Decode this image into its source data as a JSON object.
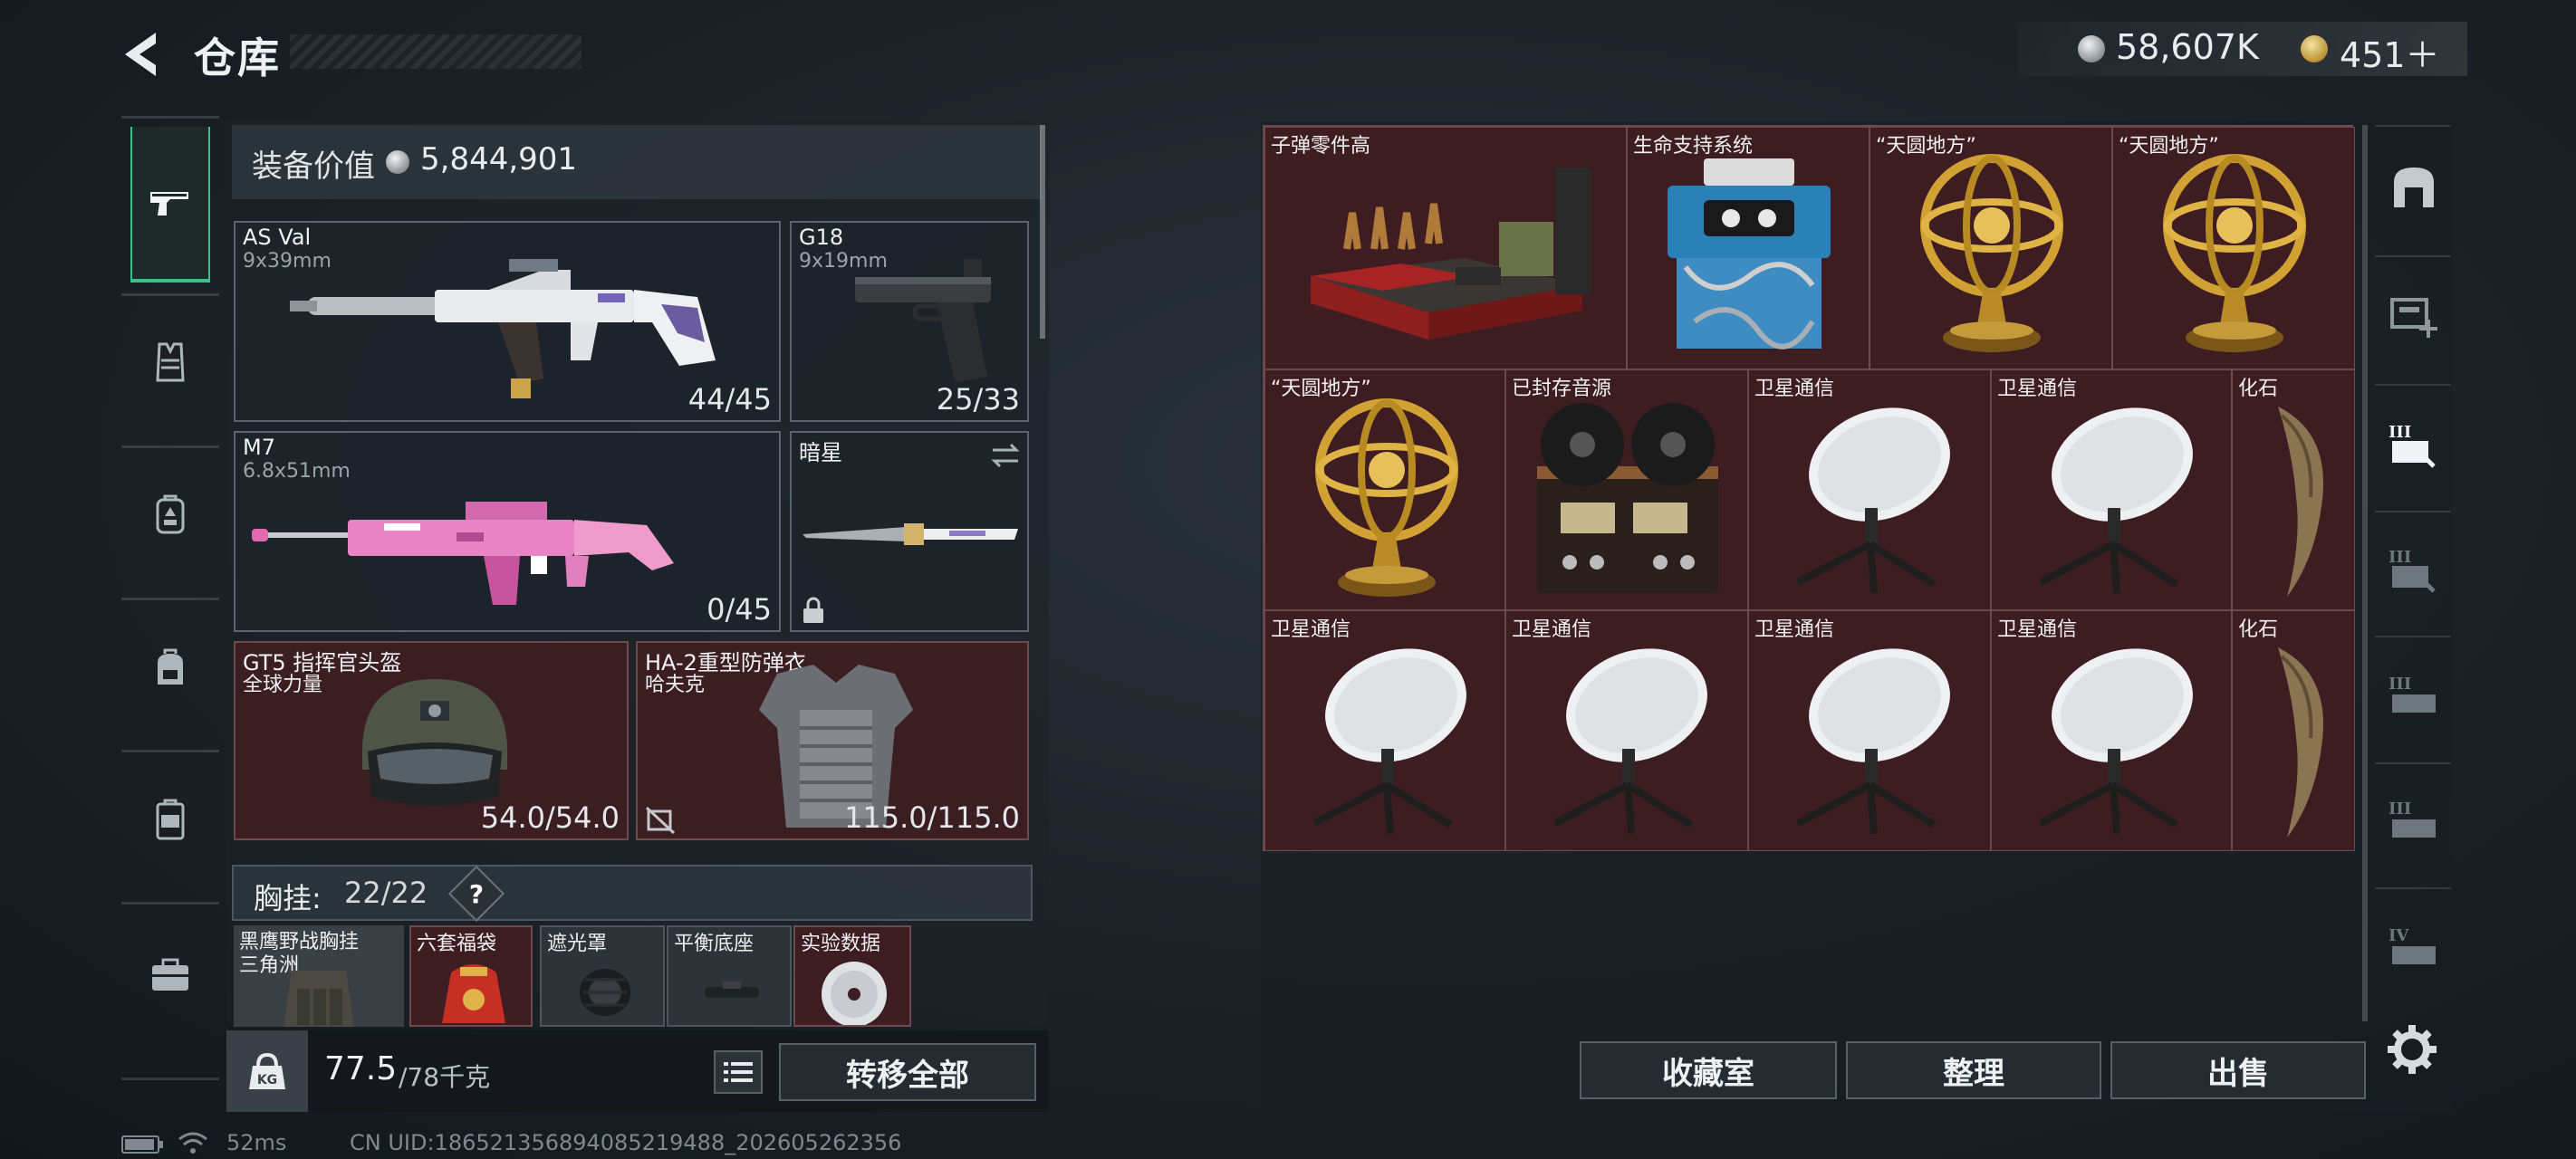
{
  "header": {
    "title": "仓库",
    "currencies": [
      {
        "name": "silver",
        "amount": "58,607K"
      },
      {
        "name": "gold",
        "amount": "451＋"
      }
    ]
  },
  "left_rail": {
    "items": [
      {
        "icon": "pistol-icon",
        "active": true
      },
      {
        "icon": "vest-icon",
        "active": false
      },
      {
        "icon": "backpack-upgrade-icon",
        "active": false
      },
      {
        "icon": "backpack-icon",
        "active": false
      },
      {
        "icon": "container-icon",
        "active": false
      },
      {
        "icon": "toolbox-icon",
        "active": false
      }
    ]
  },
  "equipment": {
    "value_label": "装备价值",
    "value_amount": "5,844,901",
    "weapons": [
      {
        "name": "AS Val",
        "caliber": "9x39mm",
        "ammo": "44/45"
      },
      {
        "name": "G18",
        "caliber": "9x19mm",
        "ammo": "25/33"
      },
      {
        "name": "M7",
        "caliber": "6.8x51mm",
        "ammo": "0/45"
      },
      {
        "name": "暗星",
        "caliber": "",
        "ammo": ""
      }
    ],
    "helmet": {
      "name": "GT5 指挥官头盔",
      "sub": "全球力量",
      "durability": "54.0/54.0"
    },
    "armor": {
      "name": "HA-2重型防弹衣",
      "sub": "哈夫克",
      "durability": "115.0/115.0"
    },
    "chest_rig": {
      "label": "胸挂:",
      "count": "22/22",
      "help": "?",
      "items": [
        {
          "name": "黑鹰野战胸挂",
          "sub": "三角洲"
        },
        {
          "name": "六套福袋",
          "sub": ""
        },
        {
          "name": "遮光罩",
          "sub": ""
        },
        {
          "name": "平衡底座",
          "sub": ""
        },
        {
          "name": "实验数据",
          "sub": ""
        }
      ]
    },
    "weight": {
      "current": "77.5",
      "max": "/78千克"
    },
    "transfer_all": "转移全部"
  },
  "storage": {
    "items": [
      {
        "name": "子弹零件高",
        "art": "ammo-parts"
      },
      {
        "name": "生命支持系统",
        "art": "life-support"
      },
      {
        "name": "“天圆地方”",
        "art": "armillary"
      },
      {
        "name": "“天圆地方”",
        "art": "armillary"
      },
      {
        "name": "“天圆地方”",
        "art": "armillary"
      },
      {
        "name": "已封存音源",
        "art": "reel-recorder"
      },
      {
        "name": "卫星通信",
        "art": "satellite"
      },
      {
        "name": "卫星通信",
        "art": "satellite"
      },
      {
        "name": "化石",
        "art": "fossil"
      },
      {
        "name": "卫星通信",
        "art": "satellite"
      },
      {
        "name": "卫星通信",
        "art": "satellite"
      },
      {
        "name": "卫星通信",
        "art": "satellite"
      },
      {
        "name": "卫星通信",
        "art": "satellite"
      },
      {
        "name": "化石",
        "art": "fossil"
      }
    ],
    "buttons": {
      "collection": "收藏室",
      "organize": "整理",
      "sell": "出售"
    }
  },
  "right_rail": {
    "items": [
      {
        "icon": "safehouse-icon",
        "label": ""
      },
      {
        "icon": "add-storage-icon",
        "label": ""
      },
      {
        "icon": "storage-page-icon",
        "label": "III"
      },
      {
        "icon": "storage-page-icon",
        "label": "III"
      },
      {
        "icon": "storage-page-icon",
        "label": "III"
      },
      {
        "icon": "storage-page-icon",
        "label": "III"
      },
      {
        "icon": "storage-page-icon",
        "label": "IV"
      }
    ]
  },
  "status": {
    "ping": "52ms",
    "uid": "CN UID:1865213568940852194​88_202605262356"
  },
  "colors": {
    "accent_green": "#39c18a",
    "red_cell": "#3d1d22",
    "text": "#eef1f3"
  }
}
